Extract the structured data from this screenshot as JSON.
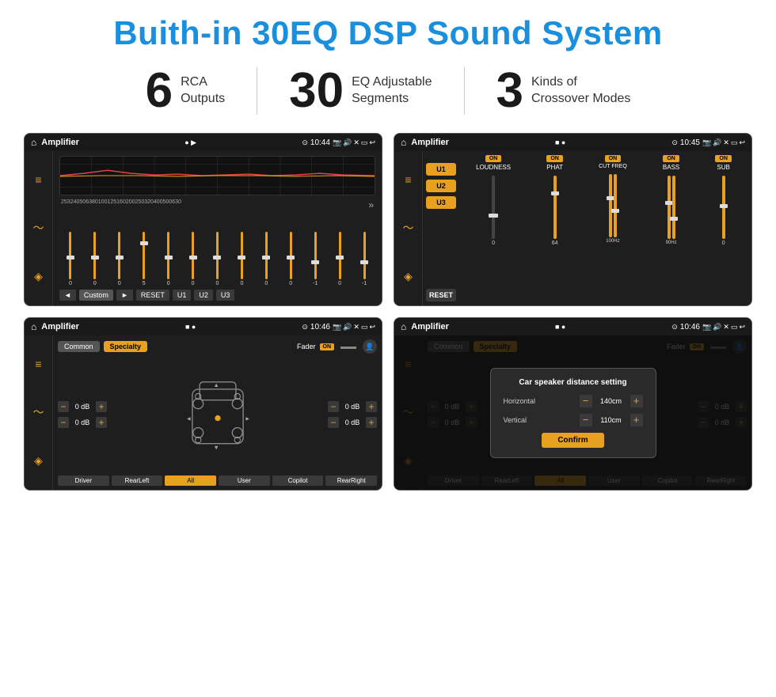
{
  "header": {
    "title": "Buith-in 30EQ DSP Sound System"
  },
  "stats": [
    {
      "number": "6",
      "line1": "RCA",
      "line2": "Outputs"
    },
    {
      "number": "30",
      "line1": "EQ Adjustable",
      "line2": "Segments"
    },
    {
      "number": "3",
      "line1": "Kinds of",
      "line2": "Crossover Modes"
    }
  ],
  "screens": [
    {
      "id": "eq-screen",
      "statusBar": {
        "appName": "Amplifier",
        "time": "10:44"
      }
    },
    {
      "id": "crossover-screen",
      "statusBar": {
        "appName": "Amplifier",
        "time": "10:45"
      }
    },
    {
      "id": "fader-screen",
      "statusBar": {
        "appName": "Amplifier",
        "time": "10:46"
      }
    },
    {
      "id": "dialog-screen",
      "statusBar": {
        "appName": "Amplifier",
        "time": "10:46"
      },
      "dialog": {
        "title": "Car speaker distance setting",
        "horizontalLabel": "Horizontal",
        "horizontalValue": "140cm",
        "verticalLabel": "Vertical",
        "verticalValue": "110cm",
        "confirmLabel": "Confirm"
      }
    }
  ],
  "eqScreen": {
    "freqLabels": [
      "25",
      "32",
      "40",
      "50",
      "63",
      "80",
      "100",
      "125",
      "160",
      "200",
      "250",
      "320",
      "400",
      "500",
      "630"
    ],
    "values": [
      "0",
      "0",
      "0",
      "5",
      "0",
      "0",
      "0",
      "0",
      "0",
      "0",
      "-1",
      "0",
      "-1"
    ],
    "buttons": [
      "◄",
      "Custom",
      "►",
      "RESET",
      "U1",
      "U2",
      "U3"
    ]
  },
  "crossoverScreen": {
    "presets": [
      "U1",
      "U2",
      "U3"
    ],
    "resetLabel": "RESET",
    "channels": [
      {
        "label": "LOUDNESS",
        "toggle": "ON"
      },
      {
        "label": "PHAT",
        "toggle": "ON"
      },
      {
        "label": "CUT FREQ",
        "toggle": "ON"
      },
      {
        "label": "BASS",
        "toggle": "ON"
      },
      {
        "label": "SUB",
        "toggle": "ON"
      }
    ]
  },
  "faderScreen": {
    "tabs": [
      "Common",
      "Specialty"
    ],
    "faderLabel": "Fader",
    "onLabel": "ON",
    "dbValues": [
      "0 dB",
      "0 dB",
      "0 dB",
      "0 dB"
    ],
    "bottomBtns": [
      "Driver",
      "RearLeft",
      "All",
      "User",
      "Copilot",
      "RearRight"
    ]
  },
  "dialogScreen": {
    "tabs": [
      "Common",
      "Specialty"
    ],
    "faderLabel": "Fader",
    "onLabel": "ON",
    "dialog": {
      "title": "Car speaker distance setting",
      "horizontalLabel": "Horizontal",
      "horizontalValue": "140cm",
      "verticalLabel": "Vertical",
      "verticalValue": "110cm",
      "confirmLabel": "Confirm"
    },
    "bottomBtns": [
      "Driver",
      "RearLeft",
      "All",
      "User",
      "Copilot",
      "RearRight"
    ]
  }
}
